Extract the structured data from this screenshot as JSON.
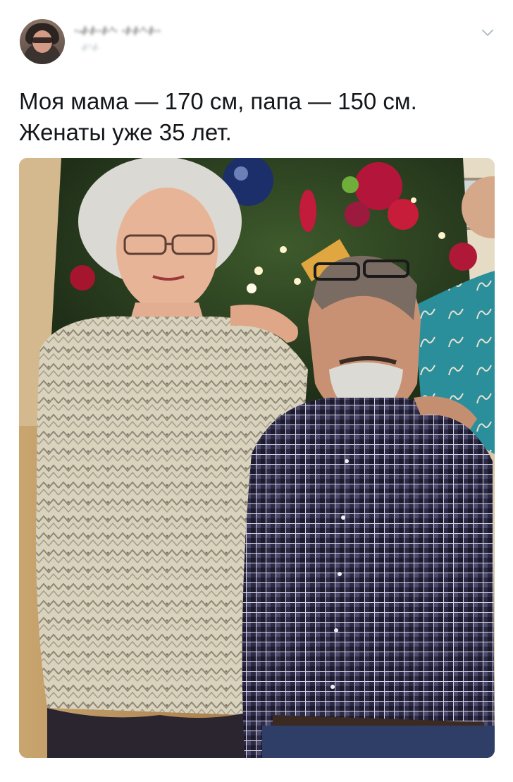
{
  "tweet": {
    "display_name": "·-/·/··/·'· ·/·/·'·/··",
    "handle": "·/·'·/·",
    "text_line_1": "Моя мама — 170 см, папа — 150 см.",
    "text_line_2": "Женаты уже 35 лет.",
    "menu_icon": "chevron-down-icon",
    "avatar_icon": "profile-avatar"
  },
  "colors": {
    "text": "#14171a",
    "secondary": "#657786",
    "chevron": "#aab8c2",
    "background": "#ffffff"
  }
}
